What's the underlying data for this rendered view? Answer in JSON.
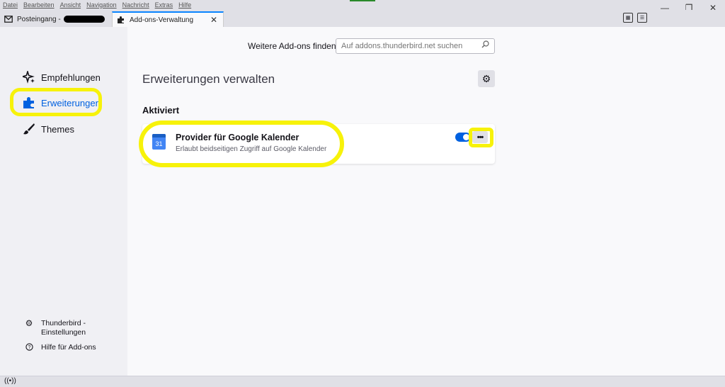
{
  "menubar": {
    "items": [
      "Datei",
      "Bearbeiten",
      "Ansicht",
      "Navigation",
      "Nachricht",
      "Extras",
      "Hilfe"
    ]
  },
  "window_controls": {
    "minimize": "—",
    "restore": "❐",
    "close": "✕"
  },
  "tabs": [
    {
      "label": "Posteingang -",
      "icon": "mail-icon",
      "active": false
    },
    {
      "label": "Add-ons-Verwaltung",
      "icon": "puzzle-icon",
      "active": true,
      "close": "✕"
    }
  ],
  "sidebar": {
    "categories": [
      {
        "label": "Empfehlungen",
        "icon": "sparkle-icon"
      },
      {
        "label": "Erweiterungen",
        "icon": "puzzle-icon",
        "selected": true
      },
      {
        "label": "Themes",
        "icon": "brush-icon"
      }
    ],
    "footer": [
      {
        "label": "Thunderbird -\nEinstellungen",
        "icon": "gear-icon"
      },
      {
        "label": "Hilfe für Add-ons",
        "icon": "help-icon"
      }
    ]
  },
  "main": {
    "find_label": "Weitere Add-ons finden",
    "search_placeholder": "Auf addons.thunderbird.net suchen",
    "title": "Erweiterungen verwalten",
    "section": "Aktiviert",
    "addon": {
      "icon_text": "31",
      "name": "Provider für Google Kalender",
      "description": "Erlaubt beidseitigen Zugriff auf Google Kalender",
      "enabled": true,
      "more_label": "•••"
    }
  },
  "colors": {
    "accent": "#0061e0",
    "highlight": "#f7f20a",
    "calendar_blue": "#4285f4"
  }
}
